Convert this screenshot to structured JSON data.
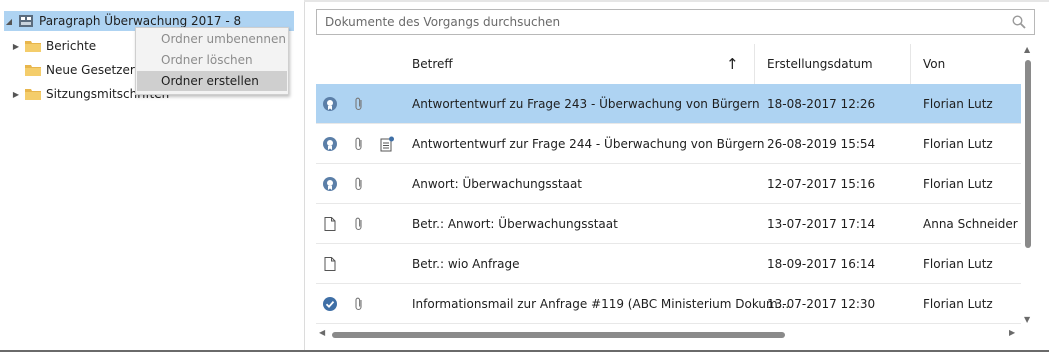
{
  "tree": {
    "root": {
      "label": "Paragraph Überwachung 2017 - 8",
      "expanded": true
    },
    "items": [
      {
        "label": "Berichte",
        "has_children": true
      },
      {
        "label": "Neue Gesetzeren",
        "has_children": false
      },
      {
        "label": "Sitzungsmitschriften",
        "has_children": true
      }
    ]
  },
  "context_menu": {
    "items": [
      {
        "label": "Ordner umbenennen",
        "enabled": false
      },
      {
        "label": "Ordner löschen",
        "enabled": false
      },
      {
        "label": "Ordner erstellen",
        "enabled": true,
        "highlighted": true
      }
    ]
  },
  "search": {
    "placeholder": "Dokumente des Vorgangs durchsuchen",
    "value": ""
  },
  "grid": {
    "columns": {
      "subject": "Betreff",
      "date": "Erstellungsdatum",
      "from": "Von"
    },
    "sort": {
      "column": "Betreff",
      "direction": "ascending"
    },
    "rows": [
      {
        "type_icon": "seal-icon",
        "attachment": true,
        "note": false,
        "subject": "Antwortentwurf zu Frage 243 - Überwachung von Bürgern",
        "date": "18-08-2017 12:26",
        "from": "Florian Lutz",
        "selected": true
      },
      {
        "type_icon": "seal-icon",
        "attachment": true,
        "note": true,
        "subject": "Antwortentwurf zur Frage 244 - Überwachung von Bürgern",
        "date": "26-08-2019 15:54",
        "from": "Florian Lutz",
        "selected": false
      },
      {
        "type_icon": "seal-icon",
        "attachment": true,
        "note": false,
        "subject": "Anwort: Überwachungsstaat",
        "date": "12-07-2017 15:16",
        "from": "Florian Lutz",
        "selected": false
      },
      {
        "type_icon": "document-icon",
        "attachment": true,
        "note": false,
        "subject": "Betr.: Anwort: Überwachungsstaat",
        "date": "13-07-2017 17:14",
        "from": "Anna Schneider",
        "selected": false
      },
      {
        "type_icon": "document-icon",
        "attachment": false,
        "note": false,
        "subject": "Betr.: wio Anfrage",
        "date": "18-09-2017 16:14",
        "from": "Florian Lutz",
        "selected": false
      },
      {
        "type_icon": "check-circle-icon",
        "attachment": true,
        "note": false,
        "subject": "Informationsmail zur Anfrage #119 (ABC Ministerium Dokum...",
        "date": "13-07-2017 12:30",
        "from": "Florian Lutz",
        "selected": false
      }
    ]
  },
  "colors": {
    "selection": "#aed3f2",
    "accent": "#3f6fa6",
    "folder": "#e8b64c"
  }
}
